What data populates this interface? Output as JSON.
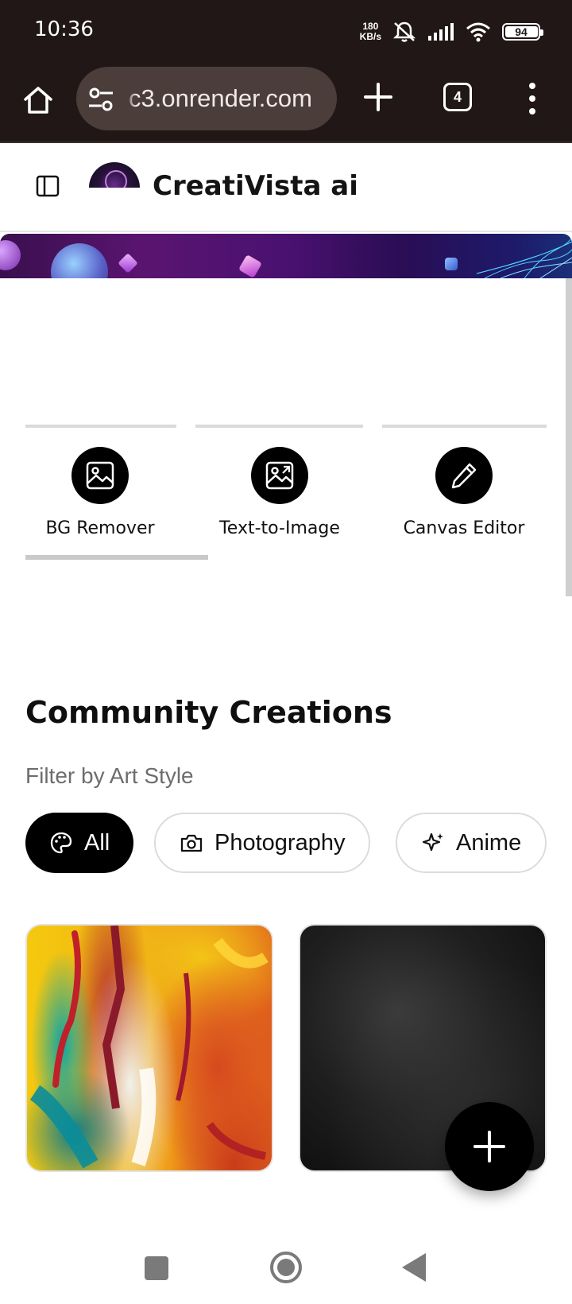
{
  "status_bar": {
    "time": "10:36",
    "net_speed_value": "180",
    "net_speed_unit": "KB/s",
    "battery_level": "94",
    "icons": [
      "mute-icon",
      "signal-icon",
      "wifi-icon",
      "battery-icon"
    ]
  },
  "browser": {
    "url_text": "c3.onrender.com",
    "tab_count": "4",
    "icons": [
      "home-icon",
      "site-settings-icon",
      "new-tab-icon",
      "tab-switcher-icon",
      "more-menu-icon"
    ]
  },
  "app": {
    "brand_title": "CreatiVista ai"
  },
  "tools": {
    "items": [
      {
        "label": "BG Remover",
        "icon": "image-icon"
      },
      {
        "label": "Text-to-Image",
        "icon": "image-icon"
      },
      {
        "label": "Canvas Editor",
        "icon": "pen-icon"
      }
    ],
    "active_index": 0
  },
  "community": {
    "title": "Community Creations",
    "filter_label": "Filter by Art Style",
    "filters": [
      {
        "label": "All",
        "icon": "palette-icon",
        "active": true
      },
      {
        "label": "Photography",
        "icon": "camera-icon",
        "active": false
      },
      {
        "label": "Anime",
        "icon": "sparkles-icon",
        "active": false
      }
    ]
  },
  "colors": {
    "status_bar_bg": "#211716",
    "url_pill_bg": "#4a3d3a",
    "accent": "#000000",
    "banner_purple": "#5a1470"
  }
}
